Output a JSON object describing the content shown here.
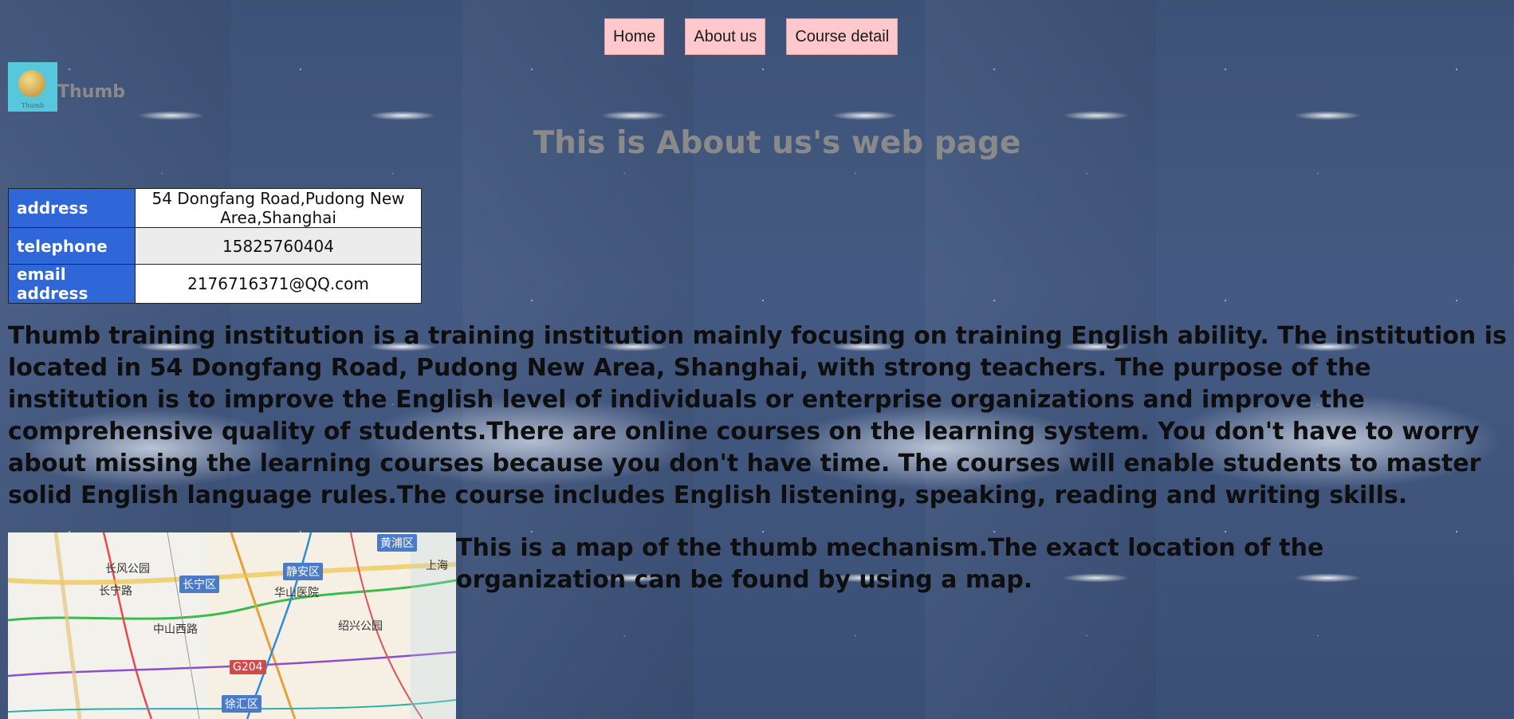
{
  "nav": {
    "items": [
      {
        "label": "Home"
      },
      {
        "label": "About us"
      },
      {
        "label": "Course detail"
      }
    ]
  },
  "logo": {
    "tiny_text": "Thumb",
    "brand": "Thumb"
  },
  "page_title": "This is About us's web page",
  "info_table": [
    {
      "label": "address",
      "value": "54 Dongfang Road,Pudong New Area,Shanghai"
    },
    {
      "label": "telephone",
      "value": "15825760404"
    },
    {
      "label": "email address",
      "value": "2176716371@QQ.com"
    }
  ],
  "description": "Thumb training institution is a training institution mainly focusing on training English ability. The institution is located in 54 Dongfang Road, Pudong New Area, Shanghai, with strong teachers. The purpose of the institution is to improve the English level of individuals or enterprise organizations and improve the comprehensive quality of students.There are online courses on the learning system. You don't have to worry about missing the learning courses because you don't have time. The courses will enable students to master solid English language rules.The course includes English listening, speaking, reading and writing skills.",
  "map": {
    "labels": {
      "huangpu": "黄浦区",
      "changfeng": "长风公园",
      "changning_road": "长宁路",
      "changning": "长宁区",
      "jingan": "静安区",
      "shanghai": "上海",
      "huashan": "华山医院",
      "xuhui": "徐汇区",
      "shaoxing": "绍兴公园",
      "zhongshan_west": "中山西路",
      "g204": "G204"
    },
    "caption": "This is a map of the thumb mechanism.The exact location of the organization can be found by using a map."
  }
}
